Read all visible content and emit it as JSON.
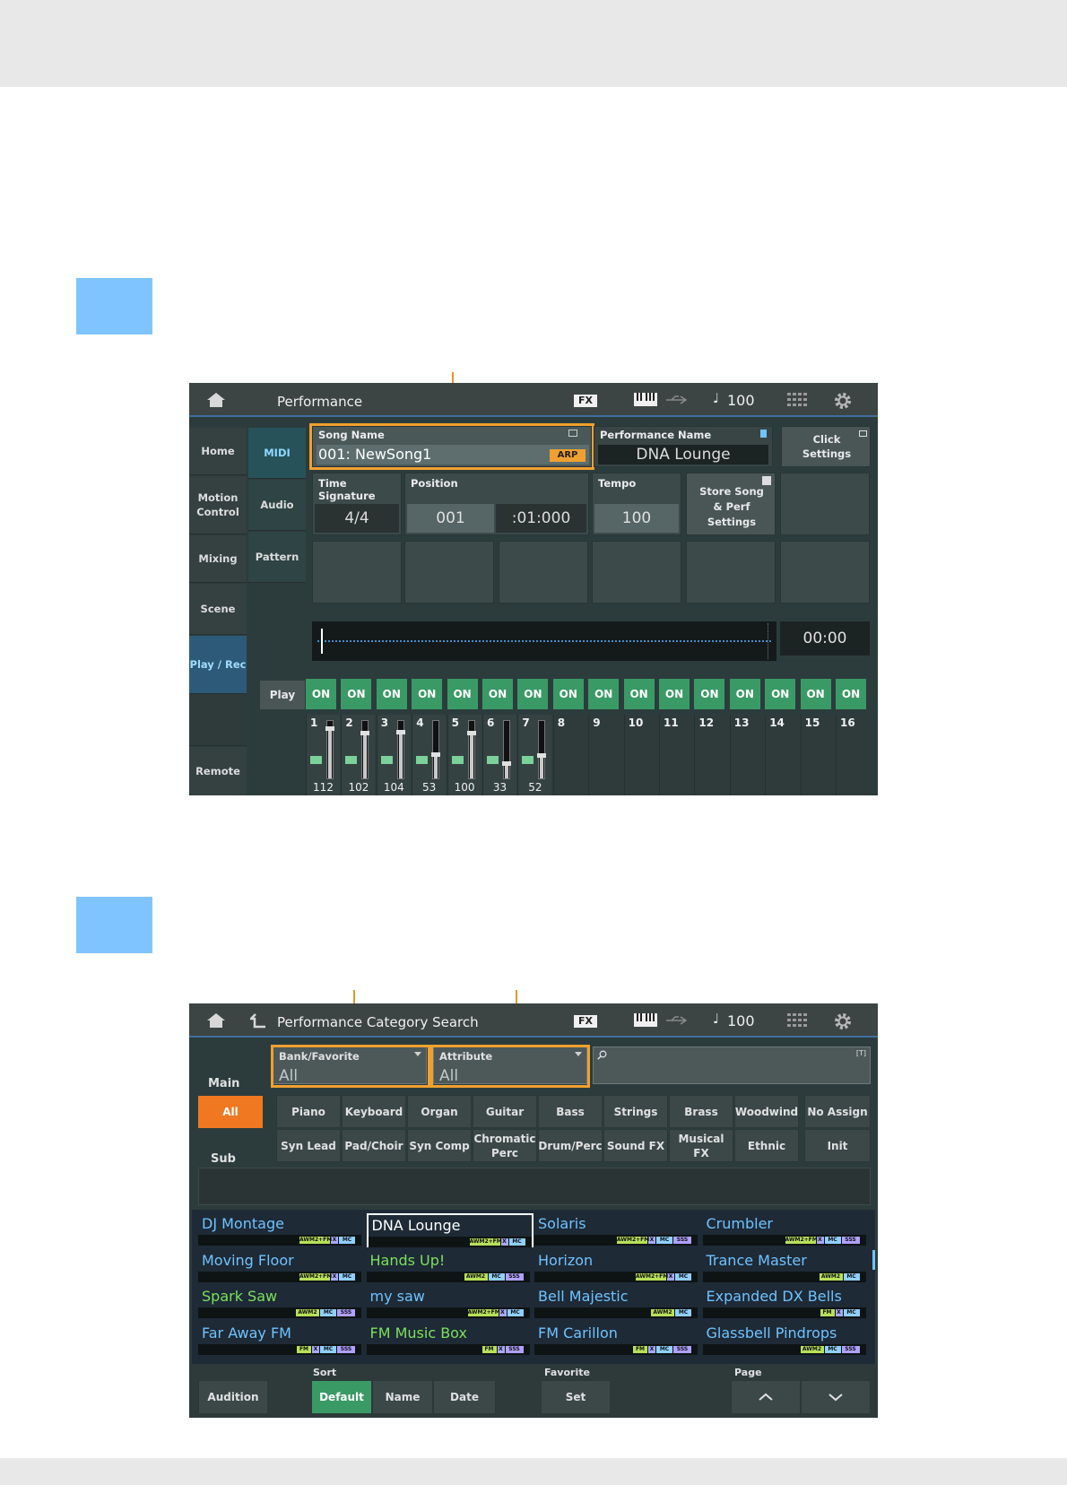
{
  "screen1": {
    "topbar": {
      "title": "Performance",
      "fx": "FX",
      "tempo": "100"
    },
    "left_nav": [
      "Home",
      "Motion Control",
      "Mixing",
      "Scene",
      "Play / Rec",
      "Remote"
    ],
    "sub_nav": [
      "MIDI",
      "Audio",
      "Pattern"
    ],
    "song_name": {
      "label": "Song Name",
      "value": "001: NewSong1",
      "badge": "ARP"
    },
    "performance_name": {
      "label": "Performance Name",
      "value": "DNA Lounge"
    },
    "click_settings": "Click Settings",
    "time_signature": {
      "label": "Time Signature",
      "value": "4/4"
    },
    "position": {
      "label": "Position",
      "measure": "001",
      "beat": ":01:000"
    },
    "tempo": {
      "label": "Tempo",
      "value": "100"
    },
    "store_button": "Store Song & Perf Settings",
    "time_display": "00:00",
    "play_label": "Play",
    "on_label": "ON",
    "parts": [
      {
        "num": "1",
        "vol": "112",
        "level": 0.88
      },
      {
        "num": "2",
        "vol": "102",
        "level": 0.8
      },
      {
        "num": "3",
        "vol": "104",
        "level": 0.82
      },
      {
        "num": "4",
        "vol": "53",
        "level": 0.42
      },
      {
        "num": "5",
        "vol": "100",
        "level": 0.79
      },
      {
        "num": "6",
        "vol": "33",
        "level": 0.26
      },
      {
        "num": "7",
        "vol": "52",
        "level": 0.41
      },
      {
        "num": "8"
      },
      {
        "num": "9"
      },
      {
        "num": "10"
      },
      {
        "num": "11"
      },
      {
        "num": "12"
      },
      {
        "num": "13"
      },
      {
        "num": "14"
      },
      {
        "num": "15"
      },
      {
        "num": "16"
      }
    ]
  },
  "screen2": {
    "topbar": {
      "title": "Performance Category Search",
      "fx": "FX",
      "tempo": "100"
    },
    "bank_favorite": {
      "label": "Bank/Favorite",
      "value": "All"
    },
    "attribute": {
      "label": "Attribute",
      "value": "All"
    },
    "search_tag": "[T]",
    "main_label": "Main",
    "sub_label": "Sub",
    "all_button": "All",
    "categories_row1": [
      "Piano",
      "Keyboard",
      "Organ",
      "Guitar",
      "Bass",
      "Strings",
      "Brass",
      "Woodwind"
    ],
    "categories_row2": [
      "Syn Lead",
      "Pad/Choir",
      "Syn Comp",
      "Chromatic Perc",
      "Drum/Perc",
      "Sound FX",
      "Musical FX",
      "Ethnic"
    ],
    "no_assign": "No Assign",
    "init": "Init",
    "results": [
      {
        "name": "DJ Montage",
        "color": "#6fc3ff",
        "tags": [
          "AWM2+FM",
          "X",
          "MC"
        ]
      },
      {
        "name": "DNA Lounge",
        "color": "#ffffff",
        "tags": [
          "AWM2+FM",
          "X",
          "MC"
        ],
        "selected": true
      },
      {
        "name": "Solaris",
        "color": "#6fc3ff",
        "tags": [
          "AWM2+FM",
          "X",
          "MC",
          "SSS"
        ]
      },
      {
        "name": "Crumbler",
        "color": "#6fc3ff",
        "tags": [
          "AWM2+FM",
          "X",
          "MC",
          "SSS"
        ]
      },
      {
        "name": "Moving Floor",
        "color": "#6fc3ff",
        "tags": [
          "AWM2+FM",
          "X",
          "MC"
        ]
      },
      {
        "name": "Hands Up!",
        "color": "#7be05a",
        "tags": [
          "AWM2",
          "MC",
          "SSS"
        ]
      },
      {
        "name": "Horizon",
        "color": "#6fc3ff",
        "tags": [
          "AWM2+FM",
          "X",
          "MC"
        ]
      },
      {
        "name": "Trance Master",
        "color": "#6fc3ff",
        "tags": [
          "AWM2",
          "MC"
        ]
      },
      {
        "name": "Spark Saw",
        "color": "#7be05a",
        "tags": [
          "AWM2",
          "MC",
          "SSS"
        ]
      },
      {
        "name": "my saw",
        "color": "#6fc3ff",
        "tags": [
          "AWM2+FM",
          "X",
          "MC"
        ]
      },
      {
        "name": "Bell Majestic",
        "color": "#6fc3ff",
        "tags": [
          "AWM2",
          "MC"
        ]
      },
      {
        "name": "Expanded DX Bells",
        "color": "#6fc3ff",
        "tags": [
          "FM",
          "X",
          "MC"
        ]
      },
      {
        "name": "Far Away FM",
        "color": "#6fc3ff",
        "tags": [
          "FM",
          "X",
          "MC",
          "SSS"
        ]
      },
      {
        "name": "FM Music Box",
        "color": "#7be05a",
        "tags": [
          "FM",
          "X",
          "SSS"
        ]
      },
      {
        "name": "FM Carillon",
        "color": "#6fc3ff",
        "tags": [
          "FM",
          "X",
          "MC",
          "SSS"
        ]
      },
      {
        "name": "Glassbell Pindrops",
        "color": "#6fc3ff",
        "tags": [
          "AWM2",
          "MC",
          "SSS"
        ]
      }
    ],
    "bottom": {
      "audition": "Audition",
      "sort_label": "Sort",
      "sort_default": "Default",
      "sort_name": "Name",
      "sort_date": "Date",
      "favorite_label": "Favorite",
      "favorite_set": "Set",
      "page_label": "Page"
    }
  },
  "colors": {
    "accent_orange": "#f0a030",
    "step_blue": "#80c4ff",
    "on_green": "#3a9a66"
  }
}
